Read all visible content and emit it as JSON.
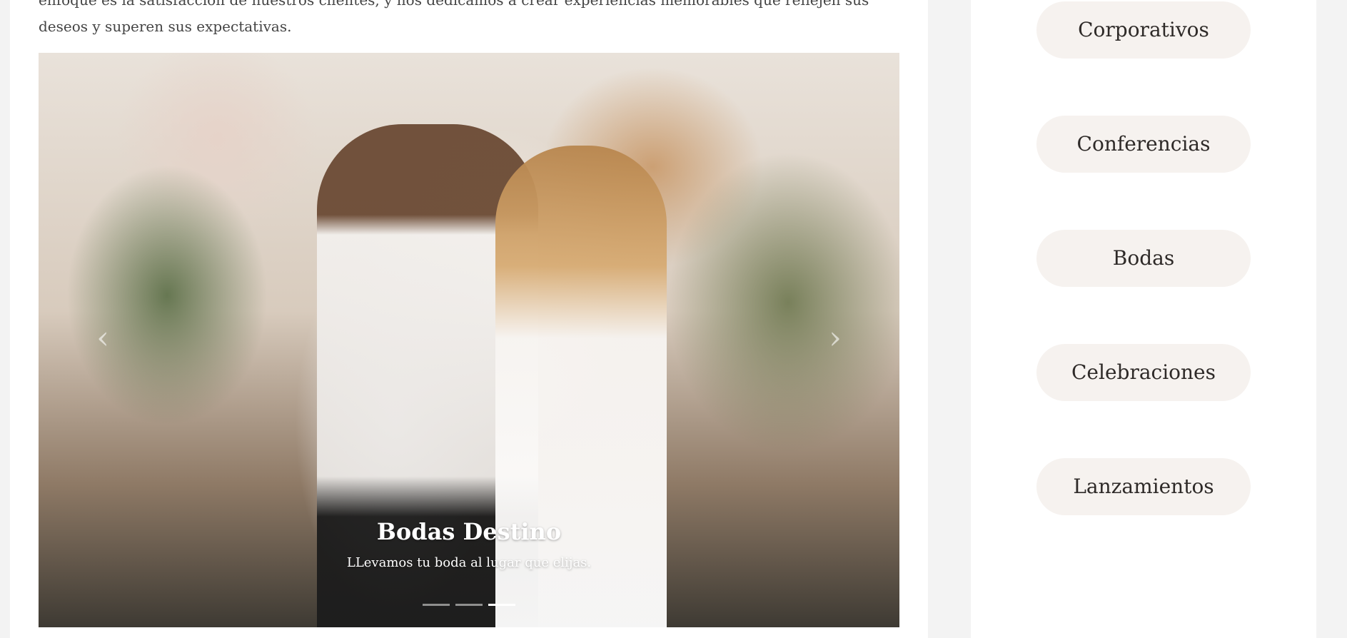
{
  "intro": {
    "text": "enfoque es la satisfacción de nuestros clientes, y nos dedicamos a crear experiencias memorables que reflejen sus deseos y superen sus expectativas."
  },
  "carousel": {
    "caption_title": "Bodas Destino",
    "caption_subtitle": "LLevamos tu boda al lugar que elijas.",
    "indicator_count": 3,
    "active_indicator": 3
  },
  "categories": [
    {
      "label": "Corporativos"
    },
    {
      "label": "Conferencias"
    },
    {
      "label": "Bodas"
    },
    {
      "label": "Celebraciones"
    },
    {
      "label": "Lanzamientos"
    }
  ],
  "colors": {
    "page_background": "#f3f3f3",
    "panel_background": "#ffffff",
    "category_button": "#f6f2ef",
    "text": "#2e2a28"
  }
}
